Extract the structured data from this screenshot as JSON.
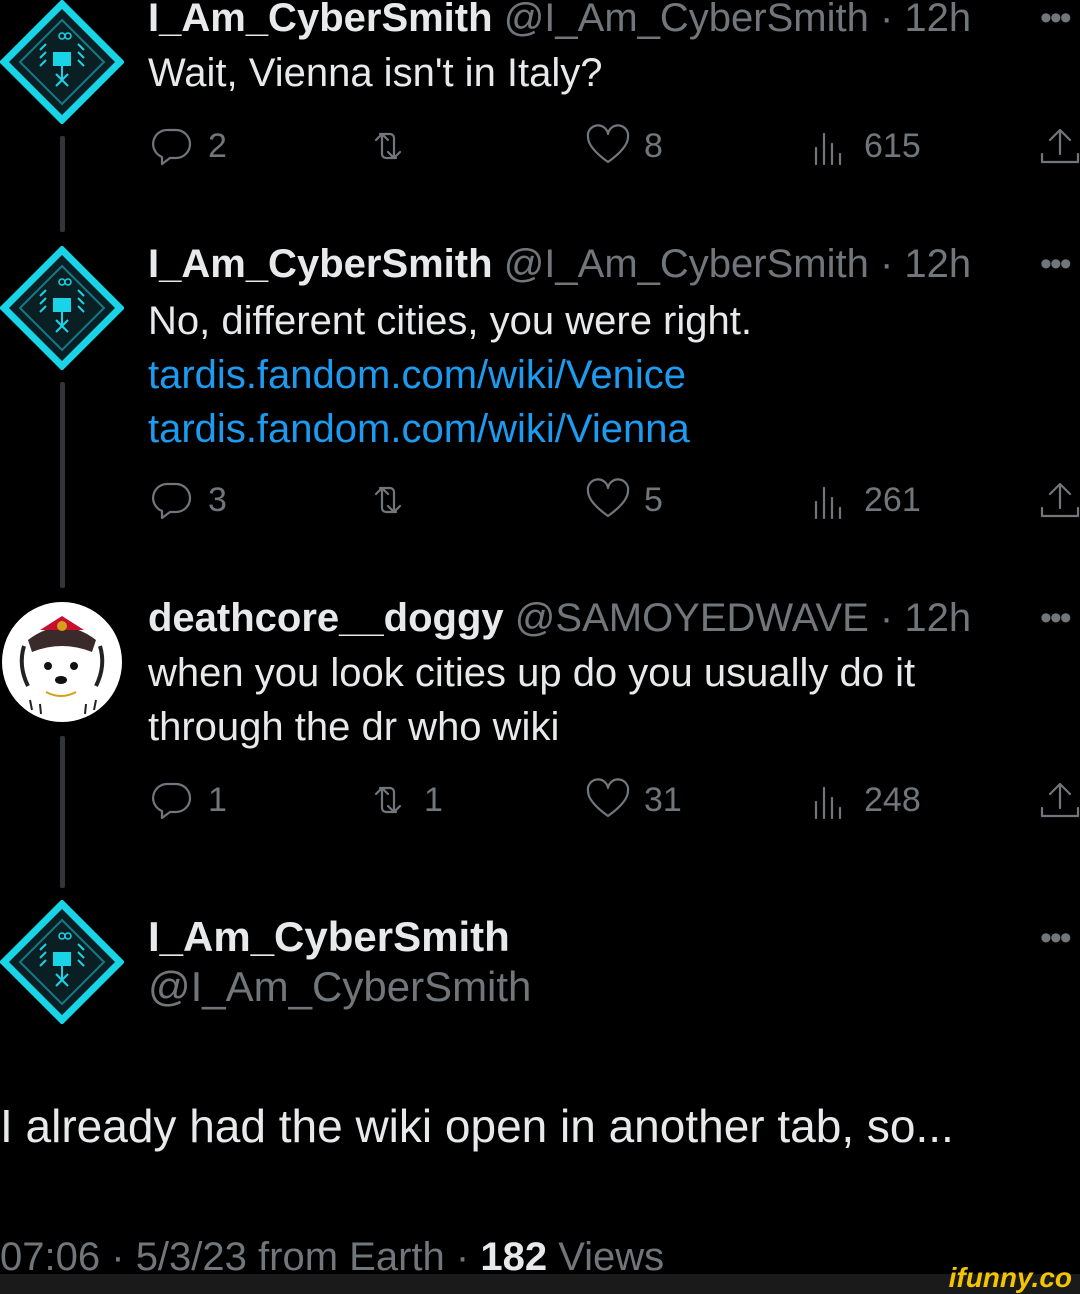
{
  "tweets": [
    {
      "name": "I_Am_CyberSmith",
      "handle": "@I_Am_CyberSmith",
      "sep": "·",
      "time": "12h",
      "text_lines": [
        "Wait, Vienna isn't in Italy?"
      ],
      "links": [],
      "replies": "2",
      "retweets": "",
      "likes": "8",
      "views": "615",
      "avatar_icon": "cybersmith-diamond-avatar-icon"
    },
    {
      "name": "I_Am_CyberSmith",
      "handle": "@I_Am_CyberSmith",
      "sep": "·",
      "time": "12h",
      "text_lines": [
        "No, different cities, you were right."
      ],
      "links": [
        "tardis.fandom.com/wiki/Venice",
        "tardis.fandom.com/wiki/Vienna"
      ],
      "replies": "3",
      "retweets": "",
      "likes": "5",
      "views": "261",
      "avatar_icon": "cybersmith-diamond-avatar-icon"
    },
    {
      "name": "deathcore__doggy",
      "handle": "@SAMOYEDWAVE",
      "sep": "·",
      "time": "12h",
      "text_lines": [
        "when you look cities up do you usually do it",
        "through the dr who wiki"
      ],
      "links": [],
      "replies": "1",
      "retweets": "1",
      "likes": "31",
      "views": "248",
      "avatar_icon": "samoyed-samurai-avatar-icon"
    }
  ],
  "main_tweet": {
    "name": "I_Am_CyberSmith",
    "handle": "@I_Am_CyberSmith",
    "text": "I already had the wiki open in another tab, so...",
    "time": "07:06",
    "date": "5/3/23",
    "source": "from Earth",
    "views_count": "182",
    "views_label": "Views",
    "sep": "·"
  },
  "more_label": "•••",
  "watermark": "ifunny.co",
  "colors": {
    "background": "#000000",
    "text": "#e7e9ea",
    "muted": "#71767b",
    "link": "#1d9bf0",
    "avatar_cyan": "#19d3e6",
    "watermark": "#f5c400"
  }
}
